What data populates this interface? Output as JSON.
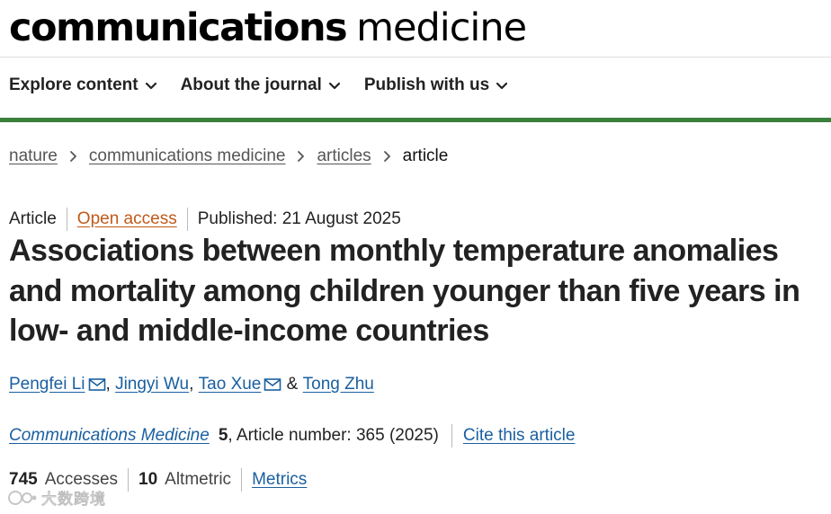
{
  "masthead": {
    "brand_bold": "communications",
    "brand_light": "medicine"
  },
  "nav": {
    "items": [
      {
        "label": "Explore content"
      },
      {
        "label": "About the journal"
      },
      {
        "label": "Publish with us"
      }
    ]
  },
  "breadcrumb": {
    "items": [
      {
        "label": "nature"
      },
      {
        "label": "communications medicine"
      },
      {
        "label": "articles"
      }
    ],
    "current": "article"
  },
  "meta": {
    "type": "Article",
    "access": "Open access",
    "published": "Published: 21 August 2025"
  },
  "article": {
    "title": "Associations between monthly temperature anomalies and mortality among children younger than five years in low- and middle-income countries"
  },
  "authors": {
    "list": [
      {
        "name": "Pengfei Li",
        "email": true
      },
      {
        "name": "Jingyi Wu",
        "email": false
      },
      {
        "name": "Tao Xue",
        "email": true
      },
      {
        "name": "Tong Zhu",
        "email": false
      }
    ],
    "comma": ",",
    "and": "&"
  },
  "citation": {
    "journal": "Communications Medicine",
    "volume": "5",
    "article_number": ", Article number: 365 (2025)",
    "cite_label": "Cite this article"
  },
  "metrics": {
    "accesses_count": "745",
    "accesses_label": "Accesses",
    "altmetric_count": "10",
    "altmetric_label": "Altmetric",
    "metrics_link": "Metrics"
  },
  "watermark": {
    "text": "大数跨境",
    "icon": "watermark-logo-icon"
  },
  "colors": {
    "nav_rule": "#3a7f3b",
    "link": "#1a5fa0",
    "open_access": "#c05a1a"
  }
}
